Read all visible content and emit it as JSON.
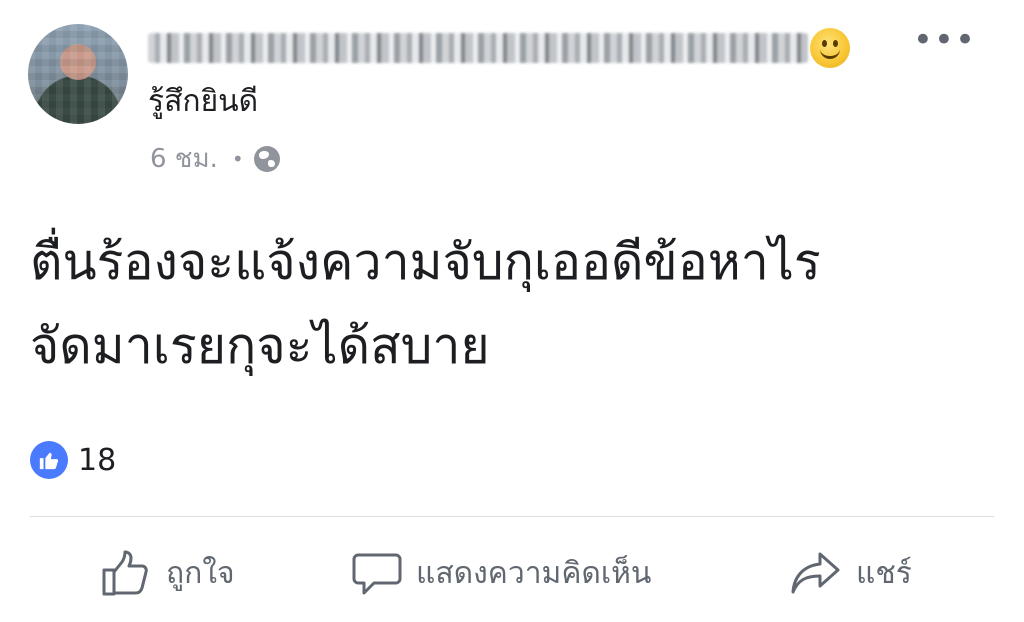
{
  "post": {
    "author_name_blurred": "",
    "feeling": "รู้สึกยินดี",
    "time": "6 ชม.",
    "separator": "•",
    "privacy_icon": "globe-icon",
    "more_icon": "more-options-icon",
    "more_label": "•••",
    "text_lines": [
      "ตื่นร้องจะแจ้งความจับกุเออดีข้อหาไร",
      "จัดมาเรยกุจะได้สบาย"
    ],
    "like_count": "18",
    "reaction_icon": "like-reaction-icon"
  },
  "actions": {
    "like_label": "ถูกใจ",
    "comment_label": "แสดงความคิดเห็น",
    "share_label": "แชร์"
  },
  "colors": {
    "text": "#1c1e21",
    "muted": "#90949c",
    "action_text": "#606770",
    "like_blue": "#4a7bff",
    "divider": "#dadde1"
  }
}
